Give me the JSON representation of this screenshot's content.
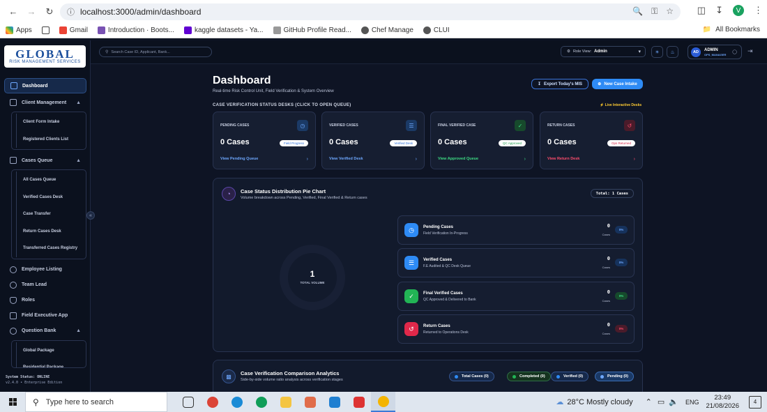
{
  "browser": {
    "url": "localhost:3000/admin/dashboard",
    "bookmarks": [
      "Apps",
      "Gmail",
      "Introduction · Boots...",
      "kaggle datasets - Ya...",
      "GitHub Profile Read...",
      "Chef Manage",
      "CLUI"
    ],
    "all_bookmarks": "All Bookmarks",
    "profile_initial": "V"
  },
  "logo": {
    "big": "GLOBAL",
    "small": "RISK MANAGEMENT SERVICES"
  },
  "sidebar": {
    "dashboard": "Dashboard",
    "client_management": "Client Management",
    "client_sub": [
      "Client Form Intake",
      "Registered Clients List"
    ],
    "cases_queue": "Cases Queue",
    "cases_sub": [
      "All Cases Queue",
      "Verified Cases Desk",
      "Case Transfer",
      "Return Cases Desk",
      "Transferred Cases Registry"
    ],
    "employee_listing": "Employee Listing",
    "team_lead": "Team Lead",
    "roles": "Roles",
    "field_exec": "Field Executive App",
    "question_bank": "Question Bank",
    "question_sub": [
      "Global Package",
      "Residential Package"
    ],
    "status_line1": "System Status: ONLINE",
    "status_line2": "v2.4.0 • Enterprise Edition"
  },
  "topbar": {
    "search_placeholder": "Search Case ID, Applicant, Bank...",
    "role_label": "Role View:",
    "role_value": "Admin",
    "user_initials": "AD",
    "user_name": "ADMIN",
    "user_role": "OPS_MANAGER"
  },
  "header": {
    "title": "Dashboard",
    "subtitle": "Real-time Risk Control Unit, Field Verification & System Overview",
    "export_label": "Export Today's MIS",
    "new_label": "New Case Intake"
  },
  "desks": {
    "section_label": "CASE VERIFICATION STATUS DESKS (CLICK TO OPEN QUEUE)",
    "live_label": "Live Interactive Desks",
    "items": [
      {
        "title": "PENDING CASES",
        "value": "0 Cases",
        "badge": "Field Progress",
        "link": "View Pending Queue",
        "color": "#4ea1ff"
      },
      {
        "title": "VERIFIED CASES",
        "value": "0 Cases",
        "badge": "Verified Desk",
        "link": "View Verified Desk",
        "color": "#4ea1ff"
      },
      {
        "title": "FINAL VERIFIED CASE",
        "value": "0 Cases",
        "badge": "QC Approved",
        "link": "View Approved Queue",
        "color": "#3ddc84"
      },
      {
        "title": "RETURN CASES",
        "value": "0 Cases",
        "badge": "Ops Returned",
        "link": "View Return Desk",
        "color": "#ff4d6d"
      }
    ]
  },
  "pie": {
    "title": "Case Status Distribution Pie Chart",
    "subtitle": "Volume breakdown across Pending, Verified, Final Verified & Return cases",
    "total": "Total: 1 Cases",
    "center_value": "1",
    "center_label": "TOTAL VOLUME",
    "legend": [
      {
        "title": "Pending Cases",
        "sub": "Field Verification In-Progress",
        "value": "0",
        "unit": "Cases",
        "pct": "0%",
        "color": "#2e8bf5"
      },
      {
        "title": "Verified Cases",
        "sub": "F.E Audited & QC Desk Queue",
        "value": "0",
        "unit": "Cases",
        "pct": "0%",
        "color": "#2e8bf5"
      },
      {
        "title": "Final Verified Cases",
        "sub": "QC Approved & Delivered to Bank",
        "value": "0",
        "unit": "Cases",
        "pct": "0%",
        "color": "#22b455"
      },
      {
        "title": "Return Cases",
        "sub": "Returned to Operations Desk",
        "value": "0",
        "unit": "Cases",
        "pct": "0%",
        "color": "#e0284a"
      }
    ]
  },
  "comparison": {
    "title": "Case Verification Comparison Analytics",
    "subtitle": "Side-by-side volume ratio analysis across verification stages",
    "chips": [
      "Total Cases (0)",
      "Completed (0)",
      "Verified (0)",
      "Pending (0)"
    ]
  },
  "taskbar": {
    "search_placeholder": "Type here to search",
    "weather": "28°C  Mostly cloudy",
    "lang": "ENG",
    "time": "23:49",
    "date": "21/08/2026",
    "notif_count": "4"
  }
}
